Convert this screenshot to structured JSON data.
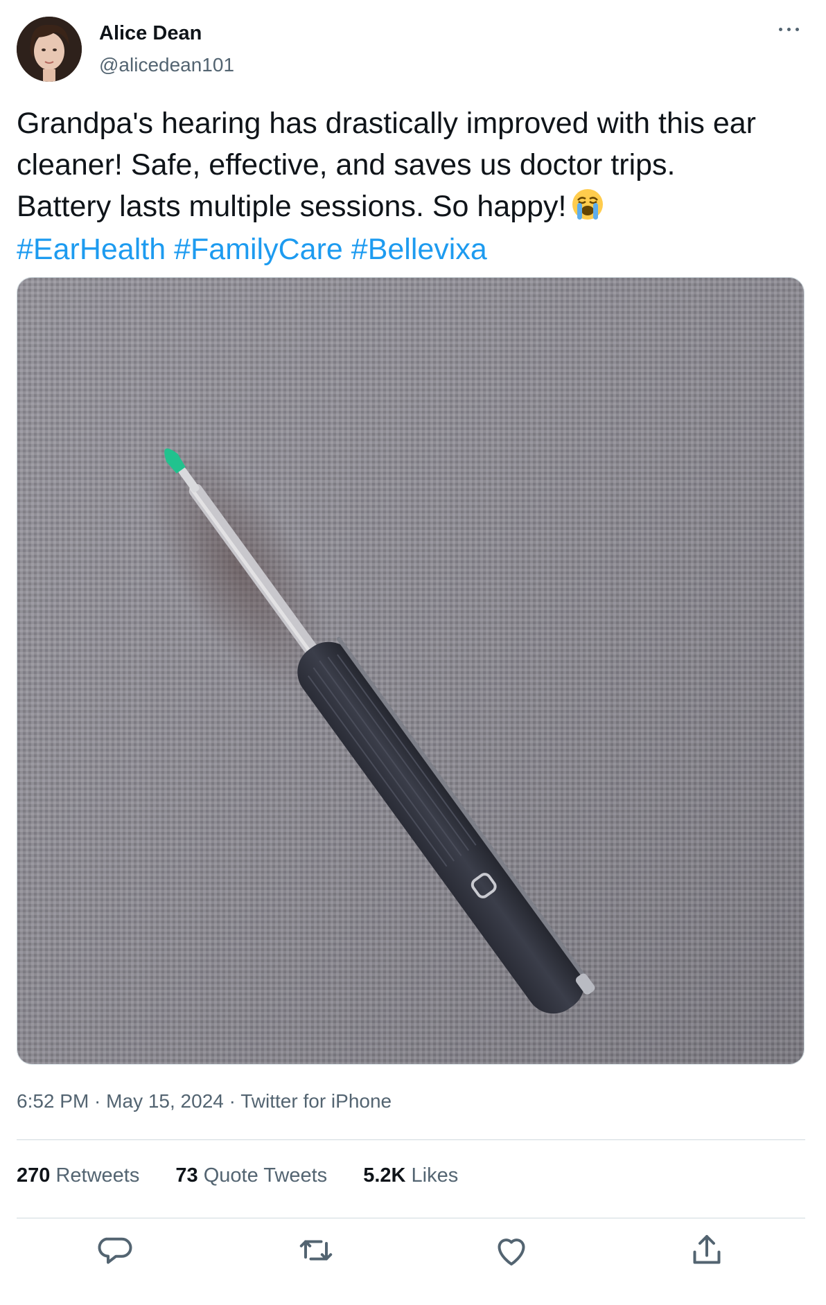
{
  "user": {
    "name": "Alice Dean",
    "handle": "@alicedean101"
  },
  "tweet": {
    "lines": [
      "Grandpa's hearing has drastically improved with this ear",
      "cleaner! Safe, effective, and saves us doctor trips.",
      "Battery lasts multiple sessions. So happy!"
    ],
    "emoji": "loudly-crying-face",
    "hashtags": [
      "#EarHealth",
      "#FamilyCare",
      "#Bellevixa"
    ],
    "media_description": "photo of ear cleaner device on grey fabric"
  },
  "meta": {
    "time": "6:52 PM",
    "separator": " · ",
    "date": "May 15, 2024",
    "source": "Twitter for iPhone"
  },
  "stats": {
    "retweets_count": "270",
    "retweets_label": "Retweets",
    "quotes_count": "73",
    "quotes_label": "Quote Tweets",
    "likes_count": "5.2K",
    "likes_label": "Likes"
  },
  "actions": [
    "reply-icon",
    "retweet-icon",
    "like-icon",
    "share-icon"
  ],
  "colors": {
    "text": "#0f1419",
    "secondary": "#536471",
    "link": "#1d9bf0",
    "border": "#cfd9de"
  }
}
